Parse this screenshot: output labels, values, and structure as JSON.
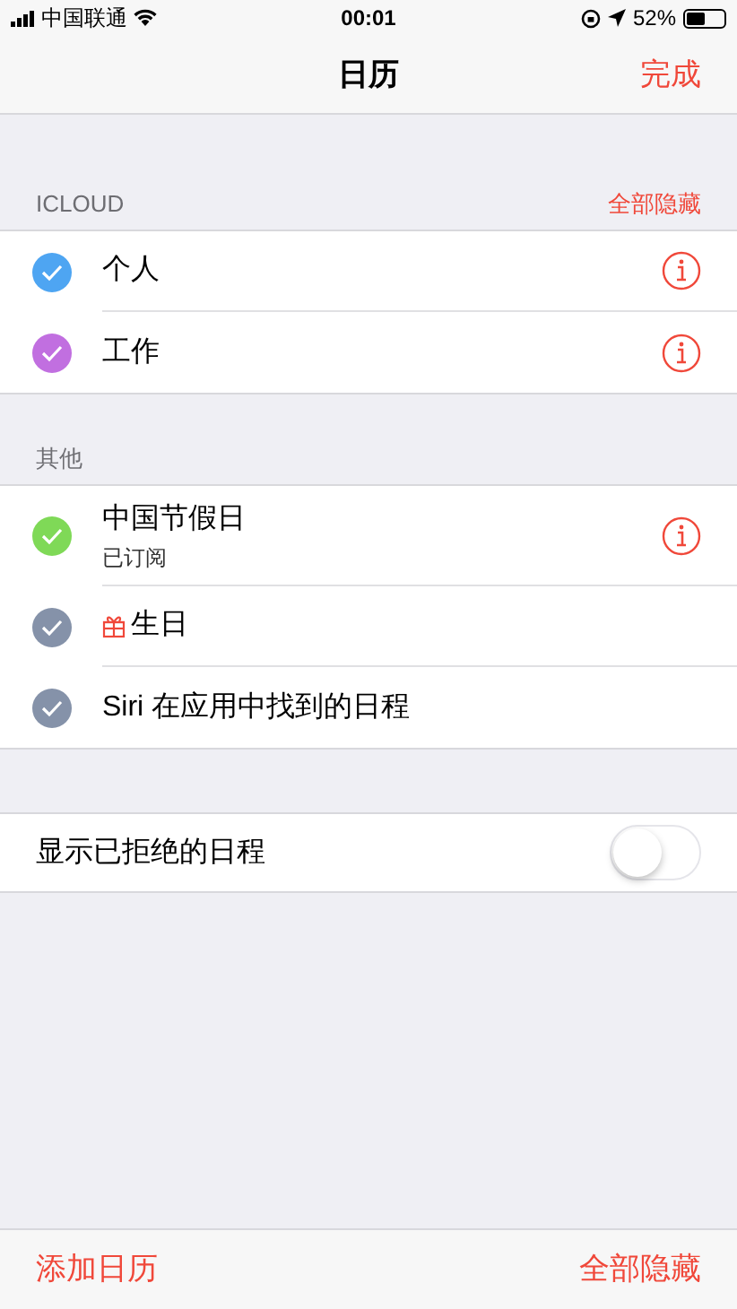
{
  "status_bar": {
    "carrier": "中国联通",
    "time": "00:01",
    "battery": "52%"
  },
  "nav": {
    "title": "日历",
    "done": "完成"
  },
  "sections": [
    {
      "header": "ICLOUD",
      "action": "全部隐藏",
      "items": [
        {
          "name": "个人",
          "checked": true,
          "color": "#4ea5f2",
          "info": true
        },
        {
          "name": "工作",
          "checked": true,
          "color": "#c16fe0",
          "info": true
        }
      ]
    },
    {
      "header": "其他",
      "items": [
        {
          "name": "中国节假日",
          "subtitle": "已订阅",
          "checked": true,
          "color": "#7fd957",
          "info": true
        },
        {
          "name": "生日",
          "checked": true,
          "color": "#8592a9",
          "info": false,
          "gift": true
        },
        {
          "name": "Siri 在应用中找到的日程",
          "checked": true,
          "color": "#8592a9",
          "info": false
        }
      ]
    }
  ],
  "declined": {
    "label": "显示已拒绝的日程",
    "on": false
  },
  "toolbar": {
    "add": "添加日历",
    "hide_all": "全部隐藏"
  }
}
